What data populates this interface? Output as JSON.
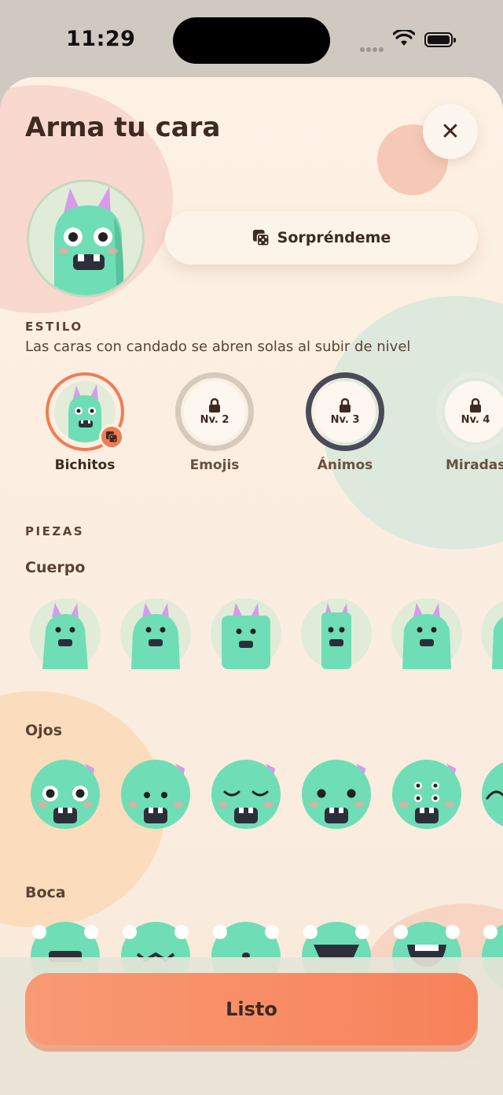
{
  "status_bar": {
    "time": "11:29"
  },
  "header": {
    "title": "Arma tu cara",
    "close_label": "✕"
  },
  "surprise_button": {
    "label": "Sorpréndeme"
  },
  "estilo": {
    "section_label": "ESTILO",
    "hint": "Las caras con candado se abren solas al subir de nivel",
    "styles": [
      {
        "name": "Bichitos",
        "selected": true,
        "locked": false
      },
      {
        "name": "Emojis",
        "level": "Nv. 2",
        "locked": true
      },
      {
        "name": "Ánimos",
        "level": "Nv. 3",
        "locked": true
      },
      {
        "name": "Miradas",
        "level": "Nv. 4",
        "locked": true
      }
    ]
  },
  "piezas": {
    "section_label": "PIEZAS",
    "groups": [
      {
        "label": "Cuerpo"
      },
      {
        "label": "Ojos"
      },
      {
        "label": "Boca"
      }
    ]
  },
  "footer": {
    "done_label": "Listo"
  },
  "colors": {
    "accent": "#F7825A",
    "monster": "#6FDDB5",
    "horn": "#D79BEA",
    "text": "#3D2A20"
  }
}
